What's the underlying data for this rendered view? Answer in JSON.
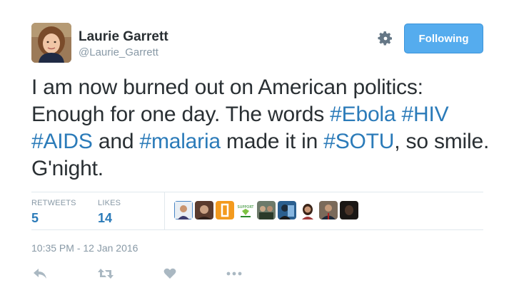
{
  "user": {
    "name": "Laurie Garrett",
    "handle": "@Laurie_Garrett"
  },
  "follow_button": {
    "label": "Following"
  },
  "tweet": {
    "segments": [
      "I am now burned out on American politics: Enough for one day. The words ",
      "#Ebola",
      " ",
      "#HIV",
      " ",
      "#AIDS",
      " and ",
      "#malaria",
      " made it in ",
      "#SOTU",
      ", so smile. G'night."
    ],
    "hashtag_color": "#2b7bb9",
    "text_color": "#292f33"
  },
  "stats": {
    "retweets_label": "RETWEETS",
    "retweets_value": "5",
    "likes_label": "LIKES",
    "likes_value": "14"
  },
  "likers": [
    {
      "name": "liker-1",
      "color": "#4a86c5"
    },
    {
      "name": "liker-2",
      "color": "#5a3b2e"
    },
    {
      "name": "liker-3",
      "color": "#f39a1e"
    },
    {
      "name": "liker-4",
      "color": "#7cc242"
    },
    {
      "name": "liker-5",
      "color": "#3d4e3b"
    },
    {
      "name": "liker-6",
      "color": "#2b5f8f"
    },
    {
      "name": "liker-7",
      "color": "#6b4a3a"
    },
    {
      "name": "liker-8",
      "color": "#4b3a34"
    },
    {
      "name": "liker-9",
      "color": "#2a2320"
    }
  ],
  "timestamp": "10:35 PM - 12 Jan 2016",
  "actions": [
    "reply-icon",
    "retweet-icon",
    "like-icon",
    "more-icon"
  ],
  "colors": {
    "accent": "#55acee",
    "link": "#2b7bb9",
    "muted": "#8899a6",
    "icon": "#aab8c2"
  }
}
